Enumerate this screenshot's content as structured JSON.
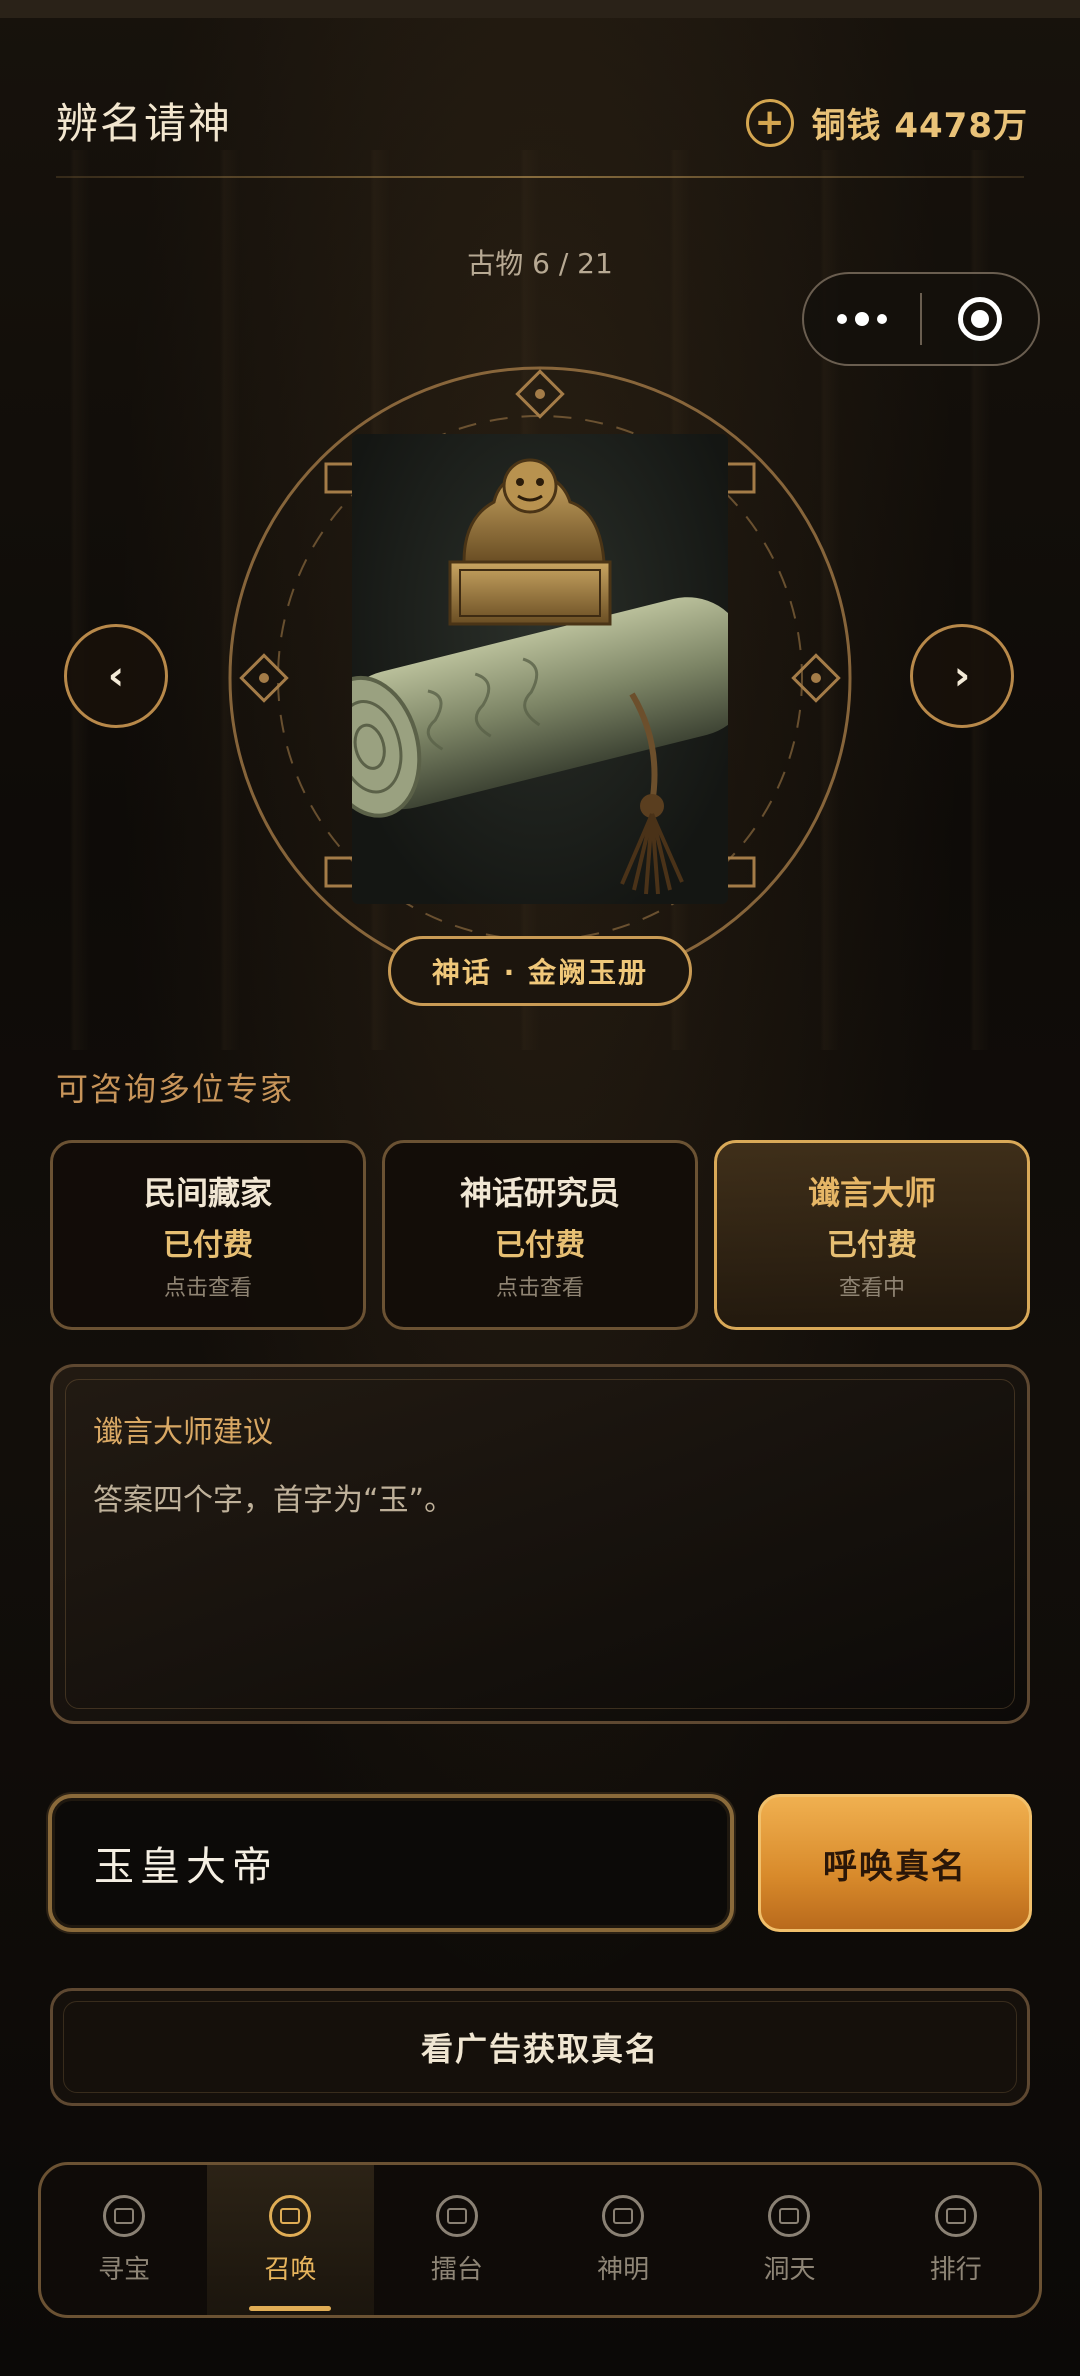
{
  "header": {
    "title": "辨名请神",
    "currency_label": "铜钱 4478万",
    "counter": "古物 6 / 21"
  },
  "icons": {
    "add": "plus-circle-icon",
    "more": "more-dots-icon",
    "close": "target-circle-icon",
    "prev": "chevron-left-icon",
    "next": "chevron-right-icon"
  },
  "artifact": {
    "label": "神话 · 金阙玉册"
  },
  "experts": {
    "section_label": "可咨询多位专家",
    "items": [
      {
        "name": "民间藏家",
        "status": "已付费",
        "hint": "点击查看",
        "active": false
      },
      {
        "name": "神话研究员",
        "status": "已付费",
        "hint": "点击查看",
        "active": false
      },
      {
        "name": "谶言大师",
        "status": "已付费",
        "hint": "查看中",
        "active": true
      }
    ]
  },
  "advice": {
    "title": "谶言大师建议",
    "text": "答案四个字，首字为“玉”。"
  },
  "answer": {
    "value": "玉皇大帝",
    "submit_label": "呼唤真名",
    "ad_label": "看广告获取真名"
  },
  "tabs": [
    {
      "label": "寻宝",
      "icon": "treasure-icon",
      "active": false
    },
    {
      "label": "召唤",
      "icon": "summon-icon",
      "active": true
    },
    {
      "label": "擂台",
      "icon": "arena-icon",
      "active": false
    },
    {
      "label": "神明",
      "icon": "deity-icon",
      "active": false
    },
    {
      "label": "洞天",
      "icon": "cave-icon",
      "active": false
    },
    {
      "label": "排行",
      "icon": "ranking-icon",
      "active": false
    }
  ],
  "colors": {
    "accent_gold": "#e0ad55",
    "button_orange": "#d88a2b",
    "background": "#0d0a07"
  }
}
